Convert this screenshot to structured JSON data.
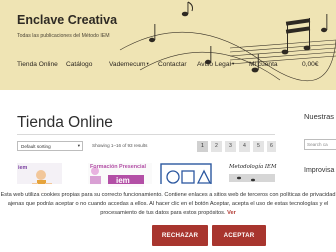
{
  "site": {
    "title": "Enclave Creativa",
    "tagline": "Todas las publicaciones del Método IEM"
  },
  "nav": {
    "items": [
      "Tienda Online",
      "Catálogo",
      "Vademecum",
      "Contactar",
      "Aviso Legal",
      "Mi cuenta"
    ],
    "caret": "▾",
    "cart": "0,00€"
  },
  "main": {
    "title": "Tienda Online",
    "sort_value": "Default sorting",
    "sort_arrow": "▾",
    "result_count": "Showing 1–16 of 93 results",
    "pages": [
      "1",
      "2",
      "3",
      "4",
      "5",
      "6"
    ],
    "current_page": "1"
  },
  "sidebar": {
    "title": "Nuestras",
    "search_placeholder": "Search ca",
    "improv": "Improvisa"
  },
  "products": {
    "p1_label": "iem",
    "p2_label": "Formación Presencial",
    "p2_badge": "iem",
    "p4_label": "Metodología IEM"
  },
  "cookie": {
    "text": "Esta web utiliza cookies propias para su correcto funcionamiento. Contiene enlaces a sitios web de terceros con políticas de privacidad ajenas que podrás aceptar o no cuando accedas a ellos. Al hacer clic en el botón Aceptar, acepta el uso de estas tecnologías y el procesamiento de tus datos para estos propósitos.",
    "link": "Ver",
    "reject": "RECHAZAR",
    "accept": "ACEPTAR"
  },
  "colors": {
    "header_bg": "#efe4b4",
    "button": "#a8352e",
    "link": "#b23a32"
  }
}
